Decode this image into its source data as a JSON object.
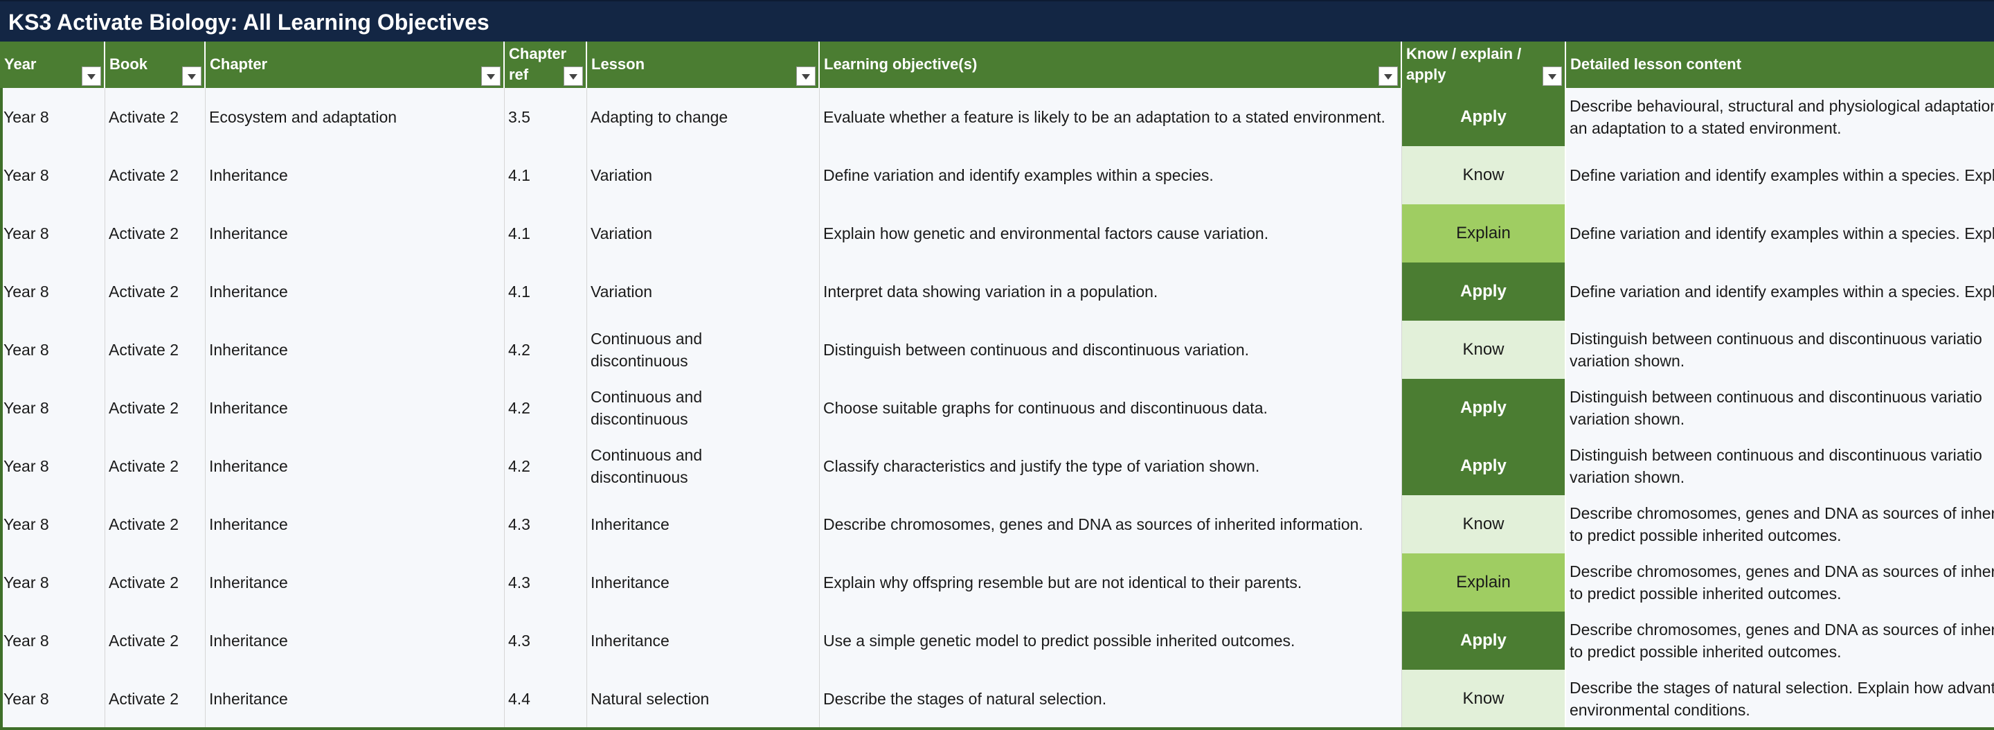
{
  "title": "KS3 Activate Biology: All Learning Objectives",
  "headers": {
    "year": "Year",
    "book": "Book",
    "chapter": "Chapter",
    "chapter_ref_line1": "Chapter",
    "chapter_ref_line2": "ref",
    "lesson": "Lesson",
    "objective": "Learning objective(s)",
    "kea_line1": "Know / explain /",
    "kea_line2": "apply",
    "detail": "Detailed lesson content"
  },
  "colors": {
    "title_bar": "#132644",
    "header_green": "#4b7d32",
    "know": "#e2f0d9",
    "explain": "#9fcd62",
    "apply": "#4b7d32"
  },
  "icons": {
    "filter": "filter-dropdown-icon"
  },
  "rows": [
    {
      "year": "Year 8",
      "book": "Activate 2",
      "chapter": "Ecosystem and adaptation",
      "ref": "3.5",
      "lesson": "Adapting to change",
      "objective": "Evaluate whether a feature is likely to be an adaptation to a stated environment.",
      "kea": "Apply",
      "detail": "Describe behavioural, structural and physiological adaptations\nan adaptation to a stated environment."
    },
    {
      "year": "Year 8",
      "book": "Activate 2",
      "chapter": "Inheritance",
      "ref": "4.1",
      "lesson": "Variation",
      "objective": "Define variation and identify examples within a species.",
      "kea": "Know",
      "detail": "Define variation and identify examples within a species. Expl"
    },
    {
      "year": "Year 8",
      "book": "Activate 2",
      "chapter": "Inheritance",
      "ref": "4.1",
      "lesson": "Variation",
      "objective": "Explain how genetic and environmental factors cause variation.",
      "kea": "Explain",
      "detail": "Define variation and identify examples within a species. Expl"
    },
    {
      "year": "Year 8",
      "book": "Activate 2",
      "chapter": "Inheritance",
      "ref": "4.1",
      "lesson": "Variation",
      "objective": "Interpret data showing variation in a population.",
      "kea": "Apply",
      "detail": "Define variation and identify examples within a species. Expl"
    },
    {
      "year": "Year 8",
      "book": "Activate 2",
      "chapter": "Inheritance",
      "ref": "4.2",
      "lesson": "Continuous and\ndiscontinuous",
      "objective": "Distinguish between continuous and discontinuous variation.",
      "kea": "Know",
      "detail": "Distinguish between continuous and discontinuous variatio\nvariation shown."
    },
    {
      "year": "Year 8",
      "book": "Activate 2",
      "chapter": "Inheritance",
      "ref": "4.2",
      "lesson": "Continuous and\ndiscontinuous",
      "objective": "Choose suitable graphs for continuous and discontinuous data.",
      "kea": "Apply",
      "detail": "Distinguish between continuous and discontinuous variatio\nvariation shown."
    },
    {
      "year": "Year 8",
      "book": "Activate 2",
      "chapter": "Inheritance",
      "ref": "4.2",
      "lesson": "Continuous and\ndiscontinuous",
      "objective": "Classify characteristics and justify the type of variation shown.",
      "kea": "Apply",
      "detail": "Distinguish between continuous and discontinuous variatio\nvariation shown."
    },
    {
      "year": "Year 8",
      "book": "Activate 2",
      "chapter": "Inheritance",
      "ref": "4.3",
      "lesson": "Inheritance",
      "objective": "Describe chromosomes, genes and DNA as sources of inherited information.",
      "kea": "Know",
      "detail": "Describe chromosomes, genes and DNA as sources of inher\nto predict possible inherited outcomes."
    },
    {
      "year": "Year 8",
      "book": "Activate 2",
      "chapter": "Inheritance",
      "ref": "4.3",
      "lesson": "Inheritance",
      "objective": "Explain why offspring resemble but are not identical to their parents.",
      "kea": "Explain",
      "detail": "Describe chromosomes, genes and DNA as sources of inher\nto predict possible inherited outcomes."
    },
    {
      "year": "Year 8",
      "book": "Activate 2",
      "chapter": "Inheritance",
      "ref": "4.3",
      "lesson": "Inheritance",
      "objective": "Use a simple genetic model to predict possible inherited outcomes.",
      "kea": "Apply",
      "detail": "Describe chromosomes, genes and DNA as sources of inher\nto predict possible inherited outcomes."
    },
    {
      "year": "Year 8",
      "book": "Activate 2",
      "chapter": "Inheritance",
      "ref": "4.4",
      "lesson": "Natural selection",
      "objective": "Describe the stages of natural selection.",
      "kea": "Know",
      "detail": "Describe the stages of natural selection. Explain how advant\nenvironmental conditions."
    }
  ]
}
